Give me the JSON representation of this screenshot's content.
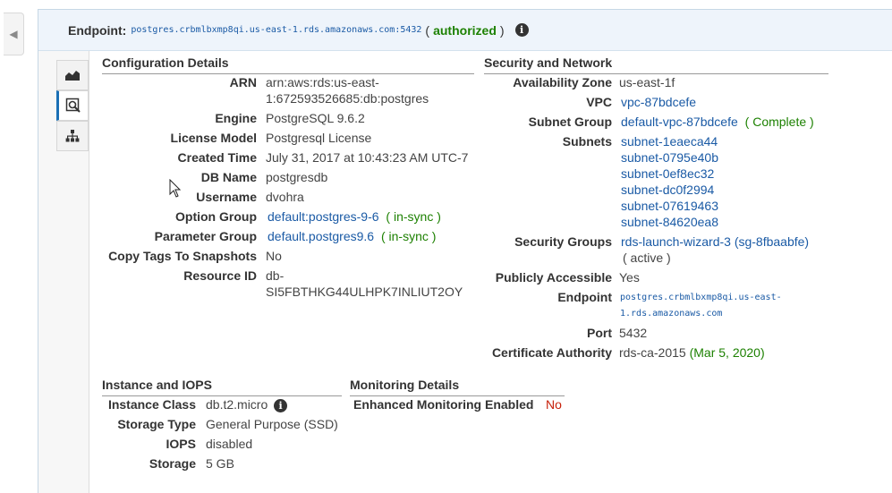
{
  "endpoint_bar": {
    "label": "Endpoint:",
    "value": "postgres.crbmlbxmp8qi.us-east-1.rds.amazonaws.com:5432",
    "paren_open": "(",
    "status": "authorized",
    "paren_close": ")"
  },
  "config": {
    "title": "Configuration Details",
    "arn_label": "ARN",
    "arn_line1": "arn:aws:rds:us-east-",
    "arn_line2": "1:672593526685:db:postgres",
    "engine_label": "Engine",
    "engine_value": "PostgreSQL 9.6.2",
    "license_label": "License Model",
    "license_value": "Postgresql License",
    "created_label": "Created Time",
    "created_value": "July 31, 2017 at 10:43:23 AM UTC-7",
    "dbname_label": "DB Name",
    "dbname_value": "postgresdb",
    "username_label": "Username",
    "username_value": "dvohra",
    "option_label": "Option Group",
    "option_value": "default:postgres-9-6",
    "option_status": "( in-sync )",
    "param_label": "Parameter Group",
    "param_value": "default.postgres9.6",
    "param_status": "( in-sync )",
    "copytags_label": "Copy Tags To Snapshots",
    "copytags_value": "No",
    "resource_label": "Resource ID",
    "resource_line1": "db-",
    "resource_line2": "SI5FBTHKG44ULHPK7INLIUT2OY"
  },
  "security": {
    "title": "Security and Network",
    "az_label": "Availability Zone",
    "az_value": "us-east-1f",
    "vpc_label": "VPC",
    "vpc_value": "vpc-87bdcefe",
    "subnetgroup_label": "Subnet Group",
    "subnetgroup_value": "default-vpc-87bdcefe",
    "subnetgroup_status": "( Complete )",
    "subnets_label": "Subnets",
    "subnets": [
      "subnet-1eaeca44",
      "subnet-0795e40b",
      "subnet-0ef8ec32",
      "subnet-dc0f2994",
      "subnet-07619463",
      "subnet-84620ea8"
    ],
    "sg_label": "Security Groups",
    "sg_value": "rds-launch-wizard-3 (sg-8fbaabfe)",
    "sg_status": "( active )",
    "public_label": "Publicly Accessible",
    "public_value": "Yes",
    "endpoint_label": "Endpoint",
    "endpoint_line1": "postgres.crbmlbxmp8qi.us-east-",
    "endpoint_line2": "1.rds.amazonaws.com",
    "port_label": "Port",
    "port_value": "5432",
    "ca_label": "Certificate Authority",
    "ca_value": "rds-ca-2015",
    "ca_date": "(Mar 5, 2020)"
  },
  "instance": {
    "title": "Instance and IOPS",
    "class_label": "Instance Class",
    "class_value": "db.t2.micro",
    "storage_type_label": "Storage Type",
    "storage_type_value": "General Purpose (SSD)",
    "iops_label": "IOPS",
    "iops_value": "disabled",
    "storage_label": "Storage",
    "storage_value": "5 GB"
  },
  "monitoring": {
    "title": "Monitoring Details",
    "enhanced_label": "Enhanced Monitoring Enabled",
    "enhanced_value": "No"
  },
  "icons": {
    "collapse": "chevron-left-icon",
    "info": "info-icon",
    "monitoring_tab": "area-chart-icon",
    "details_tab": "magnifier-icon",
    "topology_tab": "hierarchy-icon"
  },
  "colors": {
    "link": "#1a5aa5",
    "status_ok": "#1d8102",
    "status_no": "#c7210b",
    "endpoint_bar_bg": "#eef4fb"
  }
}
